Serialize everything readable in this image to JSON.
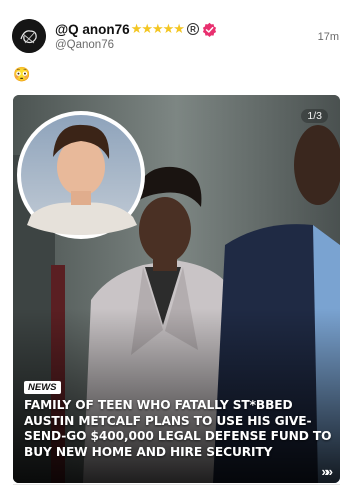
{
  "post": {
    "display_name": "@Q anon76",
    "stars": "★★★★★",
    "reg_mark": "R",
    "handle": "@Qanon76",
    "timestamp": "17m",
    "body_emoji": "😳"
  },
  "media": {
    "page_counter": "1/3",
    "badge": "NEWS",
    "headline": "FAMILY OF TEEN WHO FATALLY ST*BBED AUSTIN METCALF PLANS TO USE HIS GIVE-SEND-GO $400,000 LEGAL DEFENSE FUND TO BUY NEW HOME AND HIRE SECURITY",
    "next_glyph": "»»"
  },
  "icons": {
    "avatar": "sketch-avatar-icon",
    "verified": "verified-check-icon",
    "next": "chevrons-right-icon"
  },
  "colors": {
    "verified": "#e8306f",
    "stars": "#f3c623"
  }
}
